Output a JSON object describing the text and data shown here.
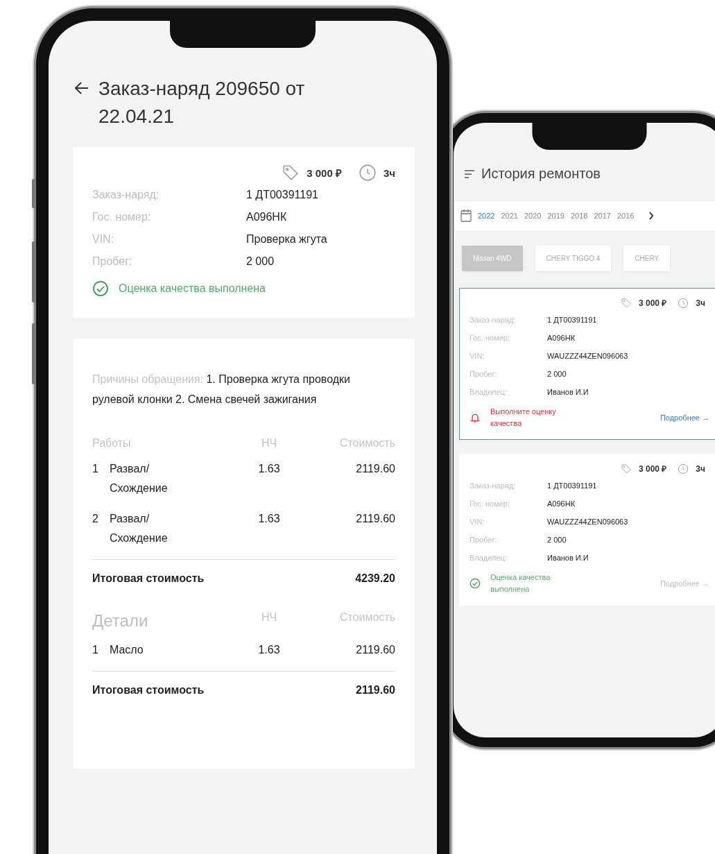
{
  "order_screen": {
    "title": "Заказ-наряд 209650 от 22.04.21",
    "summary": {
      "price": "3 000 ₽",
      "duration": "3ч",
      "fields": [
        {
          "label": "Заказ-наряд:",
          "value": "1 ДТ00391191"
        },
        {
          "label": "Гос. номер:",
          "value": "А096НК"
        },
        {
          "label": "VIN:",
          "value": "Проверка жгута"
        },
        {
          "label": "Пробег:",
          "value": "2 000"
        }
      ],
      "status": {
        "kind": "done",
        "text": "Оценка качества выполнена"
      }
    },
    "reasons": {
      "label": "Причины обращения:",
      "text": "1. Проверка жгута проводки рулевой клонки 2. Смена свечей зажигания"
    },
    "tables": [
      {
        "kind": "works",
        "columns": [
          "Работы",
          "НЧ",
          "Стоимость"
        ],
        "rows": [
          {
            "number": "1",
            "name": "Развал/ Схождение",
            "hours": "1.63",
            "cost": "2119.60"
          },
          {
            "number": "2",
            "name": "Развал/ Схождение",
            "hours": "1.63",
            "cost": "2119.60"
          }
        ],
        "total_label": "Итоговая стоимость",
        "total": "4239.20"
      },
      {
        "kind": "parts",
        "columns": [
          "Детали",
          "НЧ",
          "Стоимость"
        ],
        "rows": [
          {
            "number": "1",
            "name": "Масло",
            "hours": "1.63",
            "cost": "2119.60"
          }
        ],
        "total_label": "Итоговая стоимость",
        "total": "2119.60"
      }
    ]
  },
  "history_screen": {
    "title": "История ремонтов",
    "years": [
      {
        "label": "2022",
        "selected": true
      },
      {
        "label": "2021",
        "selected": false
      },
      {
        "label": "2020",
        "selected": false
      },
      {
        "label": "2019",
        "selected": false
      },
      {
        "label": "2018",
        "selected": false
      },
      {
        "label": "2017",
        "selected": false
      },
      {
        "label": "2016",
        "selected": false
      }
    ],
    "cars": [
      {
        "label": "Nissan 4WD",
        "selected": true
      },
      {
        "label": "CHERY TIGGO 4",
        "selected": false
      },
      {
        "label": "CHERY",
        "selected": false
      }
    ],
    "orders": [
      {
        "selected": true,
        "price": "3 000 ₽",
        "duration": "3ч",
        "fields": [
          {
            "label": "Заказ-наряд:",
            "value": "1 ДТ00391191"
          },
          {
            "label": "Гос. номер:",
            "value": "А096НК"
          },
          {
            "label": "VIN:",
            "value": "WAUZZZ44ZEN096063"
          },
          {
            "label": "Пробег:",
            "value": "2 000"
          },
          {
            "label": "Владелец:",
            "value": "Иванов И.И"
          }
        ],
        "status": {
          "kind": "pending",
          "text": "Выполните оценку качества"
        },
        "link": "Подробнее →"
      },
      {
        "selected": false,
        "price": "3 000 ₽",
        "duration": "3ч",
        "fields": [
          {
            "label": "Заказ-наряд:",
            "value": "1 ДТ00391191"
          },
          {
            "label": "Гос. номер:",
            "value": "А096НК"
          },
          {
            "label": "VIN:",
            "value": "WAUZZZ44ZEN096063"
          },
          {
            "label": "Пробег:",
            "value": "2 000"
          },
          {
            "label": "Владелец:",
            "value": "Иванов И.И"
          }
        ],
        "status": {
          "kind": "done",
          "text": "Оценка качества выполнена"
        },
        "link": "Подробнее →"
      }
    ]
  }
}
